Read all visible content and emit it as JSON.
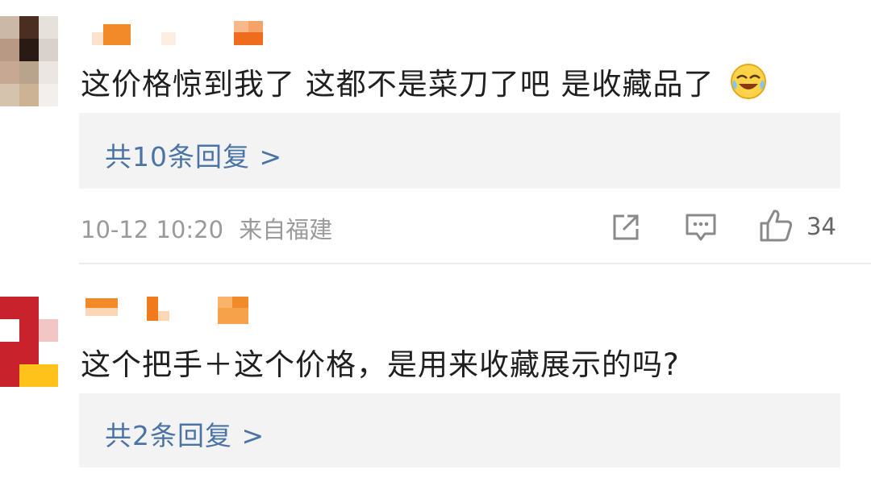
{
  "comments": [
    {
      "text": "这价格惊到我了 这都不是菜刀了吧 是收藏品了",
      "emoji": "laughing-crying-emoji",
      "replies_label": "共10条回复 >",
      "time": "10-12 10:20",
      "location": "来自福建",
      "likes": "34"
    },
    {
      "text": "这个把手＋这个价格，是用来收藏展示的吗?",
      "replies_label": "共2条回复 >"
    }
  ],
  "colors": {
    "reply_link": "#4a73a6",
    "reply_box_bg": "#f3f3f3",
    "meta_gray": "#9a9a9a",
    "pixel_orange": "#f07a1c"
  },
  "icons": [
    "share-icon",
    "comment-icon",
    "like-icon"
  ]
}
